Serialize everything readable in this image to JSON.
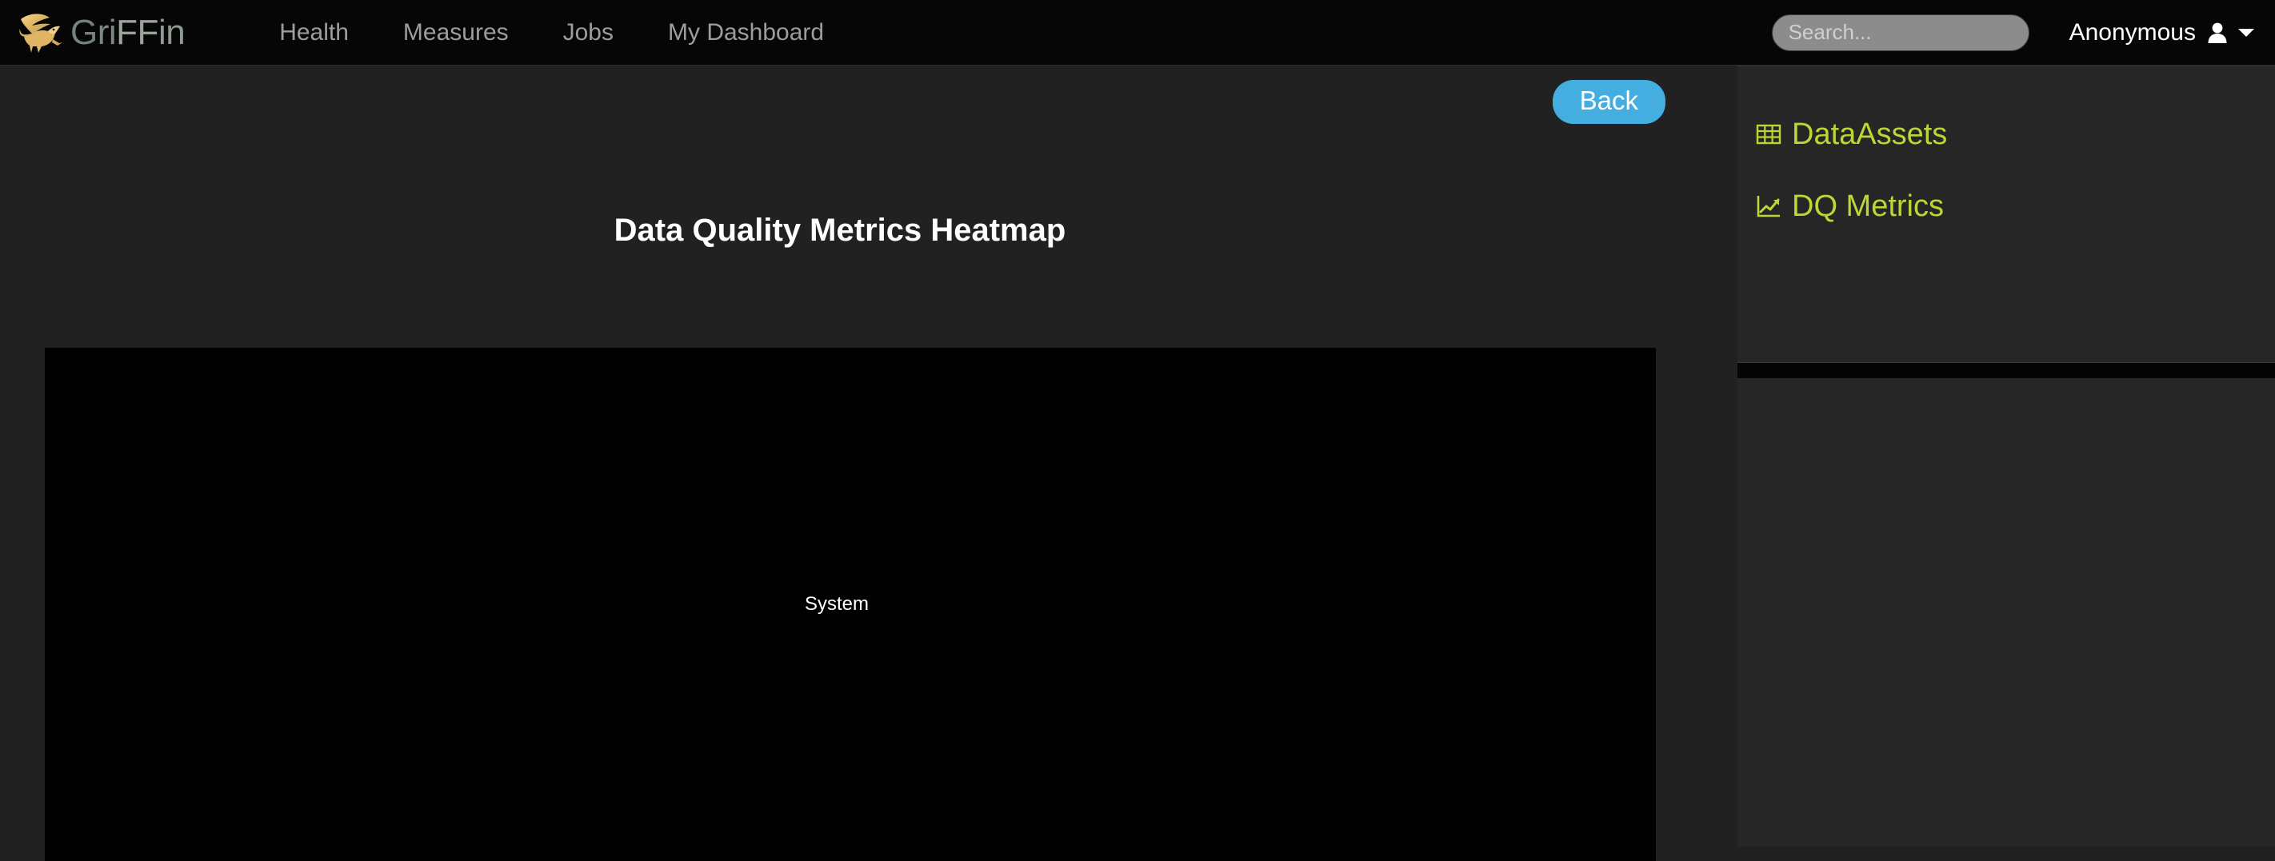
{
  "navbar": {
    "brand": {
      "icon": "griffin-logo-icon",
      "text_parts": [
        "G",
        "ri",
        "FF",
        "in"
      ],
      "full_text": "GriFFin"
    },
    "links": [
      {
        "label": "Health",
        "name": "nav-link-health"
      },
      {
        "label": "Measures",
        "name": "nav-link-measures"
      },
      {
        "label": "Jobs",
        "name": "nav-link-jobs"
      },
      {
        "label": "My Dashboard",
        "name": "nav-link-my-dashboard"
      }
    ],
    "search": {
      "placeholder": "Search...",
      "value": "",
      "icon": "search-icon"
    },
    "user": {
      "name": "Anonymous",
      "avatar_icon": "user-icon",
      "caret_icon": "chevron-down-icon"
    }
  },
  "main": {
    "back_button": "Back",
    "title": "Data Quality Metrics Heatmap",
    "heatmap_label": "System"
  },
  "sidebar": {
    "items": [
      {
        "label": "DataAssets",
        "icon": "table-grid-icon",
        "name": "sidebar-item-dataassets"
      },
      {
        "label": "DQ Metrics",
        "icon": "line-chart-icon",
        "name": "sidebar-item-dq-metrics"
      }
    ]
  },
  "colors": {
    "navbar_bg": "#060606",
    "page_bg": "#212121",
    "sidebar_bg": "#262626",
    "accent_green": "#bcd634",
    "back_button_blue": "#45aee0",
    "panel_black": "#000000",
    "nav_link_gray": "#9d9d9d",
    "search_bg": "#8c8c8c"
  },
  "chart_data": {
    "type": "heatmap",
    "title": "Data Quality Metrics Heatmap",
    "xlabel": "",
    "ylabel": "",
    "x": [],
    "y": [
      "System"
    ],
    "values": [],
    "annotations": [
      "System"
    ],
    "legend": "none",
    "grid": false,
    "background": "#000000",
    "note": "Heatmap canvas rendered empty (black) with a single centered axis label 'System'; no cells, ticks, or colorbar are visible."
  }
}
